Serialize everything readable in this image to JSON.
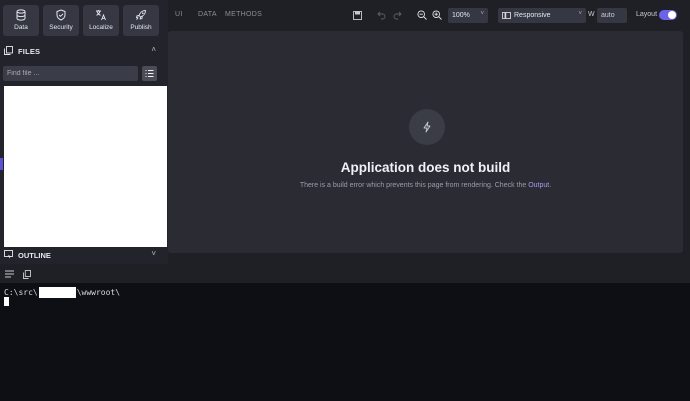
{
  "sidebar": {
    "top_buttons": [
      {
        "label": "Data",
        "icon": "database-icon"
      },
      {
        "label": "Security",
        "icon": "shield-icon"
      },
      {
        "label": "Localize",
        "icon": "translate-icon"
      },
      {
        "label": "Publish",
        "icon": "rocket-icon"
      }
    ],
    "files_title": "FILES",
    "find_placeholder": "Find file ...",
    "outline_title": "OUTLINE"
  },
  "toolbar": {
    "tabs": [
      "UI",
      "DATA",
      "METHODS"
    ],
    "zoom": "100%",
    "device": "Responsive",
    "width_label": "W",
    "width_value": "auto",
    "layout_label": "Layout",
    "layout_enabled": true
  },
  "canvas": {
    "error_title": "Application does not build",
    "error_desc_prefix": "There is a build error which prevents this page from rendering. Check the ",
    "error_desc_link": "Output",
    "error_desc_suffix": "."
  },
  "terminal": {
    "path_prefix": "C:\\src\\",
    "path_suffix": "\\wwwroot\\"
  },
  "colors": {
    "accent": "#6b63e8",
    "link": "#a39cf6",
    "terminal_bg": "#0e0f14"
  }
}
